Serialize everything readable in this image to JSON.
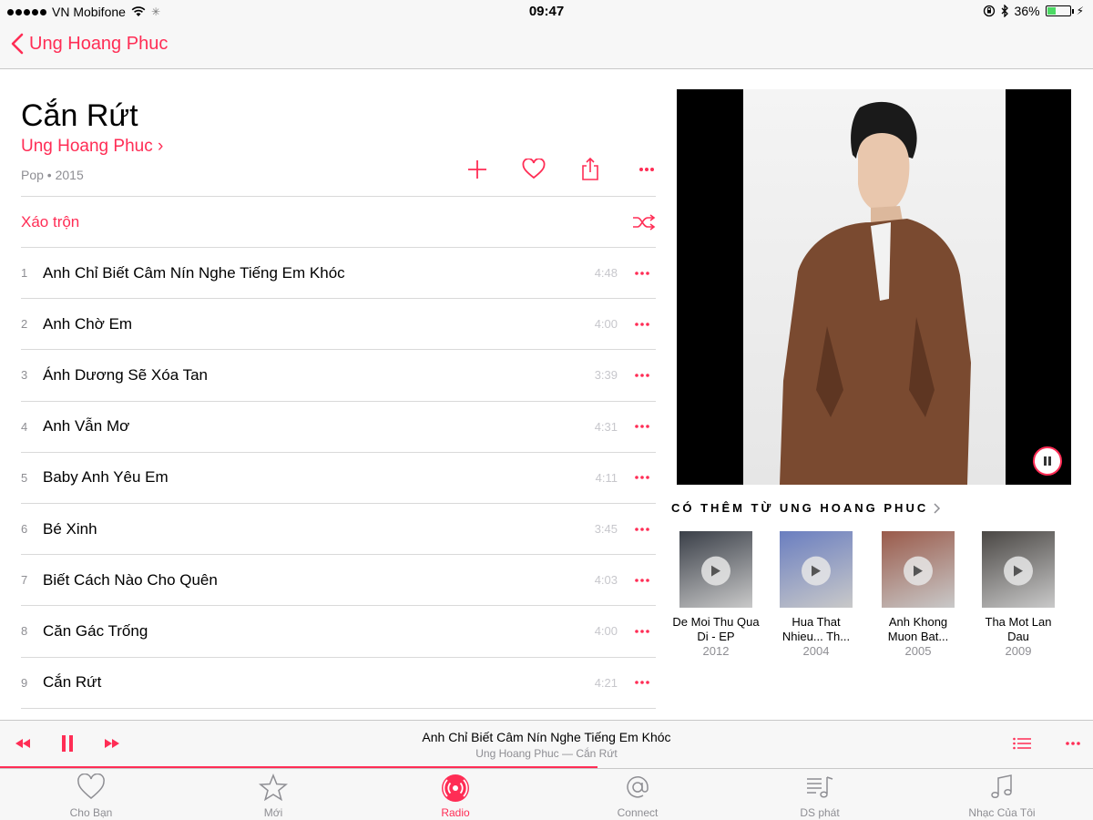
{
  "status_bar": {
    "carrier": "VN Mobifone",
    "time": "09:47",
    "battery": "36%",
    "battery_level": 0.36
  },
  "nav": {
    "back_label": "Ung Hoang Phuc"
  },
  "album": {
    "title": "Cắn Rứt",
    "artist": "Ung Hoang Phuc ›",
    "meta": "Pop • 2015"
  },
  "shuffle": {
    "label": "Xáo trộn"
  },
  "tracks": [
    {
      "num": "1",
      "title": "Anh Chỉ Biết Câm Nín Nghe Tiếng Em Khóc",
      "duration": "4:48"
    },
    {
      "num": "2",
      "title": "Anh Chờ Em",
      "duration": "4:00"
    },
    {
      "num": "3",
      "title": "Ánh Dương Sẽ Xóa Tan",
      "duration": "3:39"
    },
    {
      "num": "4",
      "title": "Anh Vẫn Mơ",
      "duration": "4:31"
    },
    {
      "num": "5",
      "title": "Baby Anh Yêu Em",
      "duration": "4:11"
    },
    {
      "num": "6",
      "title": "Bé Xinh",
      "duration": "3:45"
    },
    {
      "num": "7",
      "title": "Biết Cách Nào Cho Quên",
      "duration": "4:03"
    },
    {
      "num": "8",
      "title": "Căn Gác Trống",
      "duration": "4:00"
    },
    {
      "num": "9",
      "title": "Cắn Rứt",
      "duration": "4:21"
    }
  ],
  "more_from": {
    "label": "CÓ THÊM TỪ UNG HOANG PHUC"
  },
  "related_albums": [
    {
      "name": "De Moi Thu Qua Di - EP",
      "year": "2012",
      "cover_color": "#3a3f48"
    },
    {
      "name": "Hua That Nhieu... Th...",
      "year": "2004",
      "cover_color": "#6a7ec0"
    },
    {
      "name": "Anh Khong Muon Bat...",
      "year": "2005",
      "cover_color": "#9a5a4a"
    },
    {
      "name": "Tha Mot Lan Dau",
      "year": "2009",
      "cover_color": "#4a4744"
    }
  ],
  "now_playing": {
    "title": "Anh Chỉ Biết Câm Nín Nghe Tiếng Em Khóc",
    "subtitle": "Ung Hoang Phuc — Cắn Rứt",
    "progress": 0.547
  },
  "tabs": [
    {
      "label": "Cho Bạn",
      "icon": "heart-icon",
      "active": false
    },
    {
      "label": "Mới",
      "icon": "star-icon",
      "active": false
    },
    {
      "label": "Radio",
      "icon": "radio-icon",
      "active": true
    },
    {
      "label": "Connect",
      "icon": "at-icon",
      "active": false
    },
    {
      "label": "DS phát",
      "icon": "playlist-icon",
      "active": false
    },
    {
      "label": "Nhạc Của Tôi",
      "icon": "music-note-icon",
      "active": false
    }
  ],
  "colors": {
    "accent": "#ff2d55",
    "secondary_text": "#8e8e93"
  }
}
